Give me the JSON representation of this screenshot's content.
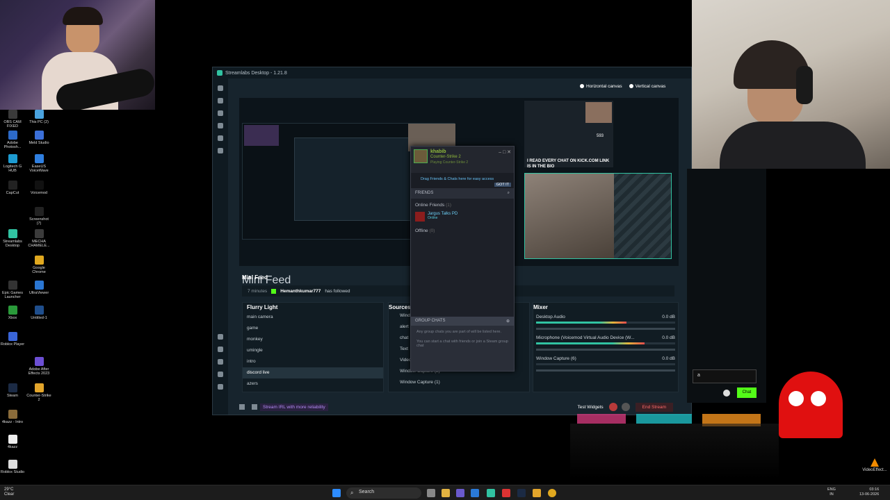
{
  "desktop": {
    "icons": [
      {
        "label": "OBS CAM FIXED",
        "color": "#3a3a3a"
      },
      {
        "label": "This PC (2)",
        "color": "#4aa3df"
      },
      {
        "label": "Adobe Photosh...",
        "color": "#2c69c7"
      },
      {
        "label": "Meld Studio",
        "color": "#3b6fd8"
      },
      {
        "label": "Logitech G HUB",
        "color": "#1d9bd1"
      },
      {
        "label": "EaseUS VoiceWave",
        "color": "#2f7fe0"
      },
      {
        "label": "CapCut",
        "color": "#222"
      },
      {
        "label": "Voicemod",
        "color": "#111"
      },
      {
        "label": "Screenshot (7)",
        "color": "#222"
      },
      {
        "label": "Streamlabs Desktop",
        "color": "#31c3a2"
      },
      {
        "label": "MECHA CHAMELE...",
        "color": "#3b3b3b"
      },
      {
        "label": "Google Chrome",
        "color": "#e0a81f"
      },
      {
        "label": "Epic Games Launcher",
        "color": "#333"
      },
      {
        "label": "UltraViewer",
        "color": "#2a76d2"
      },
      {
        "label": "Xbox",
        "color": "#2a9a3a"
      },
      {
        "label": "Untitled-1",
        "color": "#1f4e8c"
      },
      {
        "label": "Roblox Player",
        "color": "#3a65d8"
      },
      {
        "label": "Adobe After Effects 2023",
        "color": "#6c4fd3"
      },
      {
        "label": "Steam",
        "color": "#1b2a44"
      },
      {
        "label": "Counter-Strike 2",
        "color": "#e3a52b"
      },
      {
        "label": "4kazz - Intro",
        "color": "#8a6b3a"
      },
      {
        "label": "4kazz",
        "color": "#eee"
      },
      {
        "label": "Roblox Studio",
        "color": "#ddd"
      }
    ]
  },
  "streamlabs": {
    "title": "Streamlabs Desktop - 1.21.8",
    "horizontal_canvas": "Horizontal canvas",
    "vertical_canvas": "Vertical canvas",
    "overlay_text": "I READ EVERY CHAT ON KICK.COM LINK IS IN THE BIO",
    "overlay_num": "593",
    "mini_feed": {
      "title": "Mini Feed",
      "time": "7 minutes",
      "user": "Hemanthkumar777",
      "action": "has followed"
    },
    "scenes": {
      "title": "Flurry Light",
      "items": [
        "main camera",
        "game",
        "monkey",
        "umingle",
        "intro",
        "discord live",
        "azers"
      ],
      "active_index": 5
    },
    "sources": {
      "title": "Sources",
      "items": [
        "Wind",
        "alert",
        "chat",
        "Text",
        "Video",
        "Window Capture (2)",
        "Window Capture (1)"
      ]
    },
    "mixer": {
      "title": "Mixer",
      "rows": [
        {
          "name": "Desktop Audio",
          "db": "0.0 dB",
          "level": 0.65
        },
        {
          "name": "Microphone (Voicemod Virtual Audio Device (W...",
          "db": "0.0 dB",
          "level": 0.78
        },
        {
          "name": "Window Capture (6)",
          "db": "0.0 dB",
          "level": 0
        }
      ]
    },
    "footer": {
      "promo": "Stream IRL with more reliability",
      "test_widgets": "Test Widgets",
      "end_stream": "End Stream"
    }
  },
  "steam": {
    "username": "khabib",
    "game": "Counter-Strike 2",
    "status": "Playing Counter-Strike 2",
    "drag_hint": "Drag Friends & Chats here for easy access",
    "got_it": "GOT IT",
    "friends_label": "FRIENDS",
    "online_label": "Online Friends",
    "online_count": "(1)",
    "friend_name": "Jargus Talks PD",
    "friend_status": "Online",
    "offline_label": "Offline",
    "offline_count": "(0)",
    "group_chats": "GROUP CHATS",
    "group_text1": "Any group chats you are part of will be listed here.",
    "group_text2": "You can start a chat with friends or join a Steam group chat"
  },
  "chat": {
    "input_value": "a",
    "send_label": "Chat"
  },
  "taskbar": {
    "weather_temp": "29°C",
    "weather_desc": "Clear",
    "search_label": "Search",
    "lang1": "ENG",
    "lang2": "IN",
    "time": "03:16",
    "date": "13-06-2026"
  },
  "tray_app": "VideoEffect..."
}
